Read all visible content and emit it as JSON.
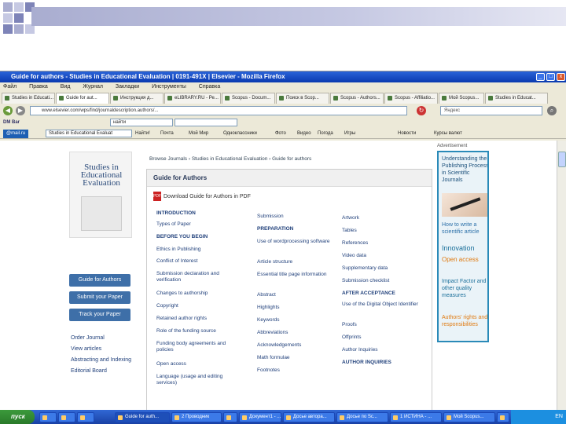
{
  "window": {
    "title": "Guide for authors - Studies in Educational Evaluation | 0191-491X | Elsevier - Mozilla Firefox",
    "menu": [
      "Файл",
      "Правка",
      "Вид",
      "Журнал",
      "Закладки",
      "Инструменты",
      "Справка"
    ]
  },
  "tabs": [
    "Studies in Educati...",
    "Guide for aut...",
    "Инструкция д...",
    "eLIBRARY.RU - Ре...",
    "Scopus - Docum...",
    "Поиск в Scop...",
    "Scopus - Authors...",
    "Scopus - Affiliatio...",
    "Мой Scopus...",
    "Studies in Educat..."
  ],
  "nav": {
    "url": "www.elsevier.com/wps/find/journaldescription.authors/...",
    "search_placeholder": "Яндекс"
  },
  "bookmarks": {
    "bar3_label": "DM Bar",
    "bar3_field": "найти",
    "bar4_items": [
      "@mail.ru",
      "Studies in Educational Evaluat",
      "Найти!",
      "Почта",
      "Мой Мир",
      "Одноклассники",
      "Фото",
      "Видео",
      "Погода",
      "Игры",
      "Новости",
      "Курсы валют"
    ]
  },
  "page": {
    "breadcrumb": "Browse Journals › Studies in Educational Evaluation › Guide for authors",
    "cover_title": "Studies in Educational Evaluation",
    "side_buttons": [
      "Guide for Authors",
      "Submit your Paper",
      "Track your Paper"
    ],
    "side_links": [
      "Order Journal",
      "View articles",
      "Abstracting and Indexing",
      "Editorial Board"
    ],
    "panel_title": "Guide for Authors",
    "pdf_label": "Download Guide for Authors in PDF",
    "col1": {
      "section1": "INTRODUCTION",
      "links1": [
        "Types of Paper"
      ],
      "section2": "BEFORE YOU BEGIN",
      "links2": [
        "Ethics in Publishing",
        "Conflict of Interest",
        "Submission declaration and verification",
        "Changes to authorship",
        "Copyright",
        "Retained author rights",
        "Role of the funding source",
        "Funding body agreements and policies",
        "Open access",
        "Language (usage and editing services)"
      ]
    },
    "col2": {
      "links1": [
        "Submission"
      ],
      "section": "PREPARATION",
      "links2": [
        "Use of wordprocessing software",
        "Article structure",
        "Essential title page information",
        "Abstract",
        "Highlights",
        "Keywords",
        "Abbreviations",
        "Acknowledgements",
        "Math formulae",
        "Footnotes"
      ]
    },
    "col3": {
      "links1": [
        "Artwork",
        "Tables",
        "References",
        "Video data",
        "Supplementary data",
        "Submission checklist"
      ],
      "section1": "AFTER ACCEPTANCE",
      "links2": [
        "Use of the Digital Object Identifier",
        "Proofs",
        "Offprints",
        "Author Inquiries"
      ],
      "section2": "AUTHOR INQUIRIES"
    },
    "sponsor": "Advertisement",
    "banner": {
      "line1": "Understanding the Publishing Process in Scientific Journals",
      "line2": "How to write a scientific article",
      "line3": "Innovation",
      "line4": "Open access",
      "line5": "Impact Factor and other quality measures",
      "line6": "Authors' rights and responsibilities"
    }
  },
  "taskbar": {
    "start": "пуск",
    "items": [
      "",
      "",
      "",
      "Guide for auth...",
      "2 Проводник",
      "",
      "Документ1 - ...",
      "Досье автора...",
      "Досье по Sc...",
      "1 ИСТИНА - ...",
      "Мой Scopus...",
      ""
    ],
    "tray": "EN"
  },
  "colors": {
    "accent": "#3e6fa8",
    "title_bar": "#0a3ab0",
    "banner_border": "#2a8ab8"
  }
}
